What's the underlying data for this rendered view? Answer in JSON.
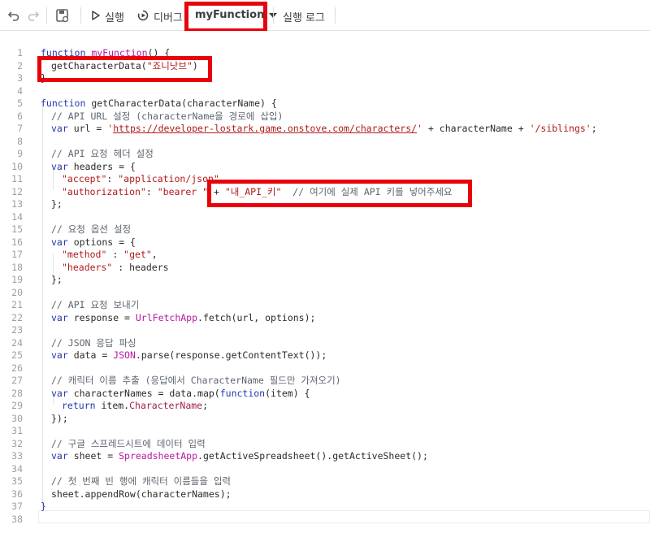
{
  "toolbar": {
    "run_label": "실행",
    "debug_label": "디버그",
    "function_name": "myFunction",
    "log_label": "실행 로그"
  },
  "code_lines": [
    {
      "n": "1",
      "indent": 0,
      "tokens": [
        [
          "kw",
          "function "
        ],
        [
          "fn",
          "myFunction"
        ],
        [
          "pl",
          "() {"
        ]
      ]
    },
    {
      "n": "2",
      "indent": 1,
      "tokens": [
        [
          "pl",
          "getCharacterData("
        ],
        [
          "str",
          "\"죠니낫브\""
        ],
        [
          "pl",
          ")"
        ]
      ]
    },
    {
      "n": "3",
      "indent": 0,
      "tokens": [
        [
          "pl",
          "}"
        ]
      ]
    },
    {
      "n": "4",
      "indent": 0,
      "tokens": []
    },
    {
      "n": "5",
      "indent": 0,
      "tokens": [
        [
          "kw",
          "function "
        ],
        [
          "pl",
          "getCharacterData(characterName) {"
        ]
      ]
    },
    {
      "n": "6",
      "indent": 1,
      "tokens": [
        [
          "cm",
          "// API URL 설정 (characterName을 경로에 삽입)"
        ]
      ]
    },
    {
      "n": "7",
      "indent": 1,
      "tokens": [
        [
          "kw",
          "var "
        ],
        [
          "pl",
          "url = "
        ],
        [
          "str",
          "'"
        ],
        [
          "url",
          "https://developer-lostark.game.onstove.com/characters/"
        ],
        [
          "str",
          "'"
        ],
        [
          "pl",
          " + characterName + "
        ],
        [
          "str",
          "'/siblings'"
        ],
        [
          "pl",
          ";"
        ]
      ]
    },
    {
      "n": "8",
      "indent": 0,
      "tokens": []
    },
    {
      "n": "9",
      "indent": 1,
      "tokens": [
        [
          "cm",
          "// API 요청 헤더 설정"
        ]
      ]
    },
    {
      "n": "10",
      "indent": 1,
      "tokens": [
        [
          "kw",
          "var "
        ],
        [
          "pl",
          "headers = {"
        ]
      ]
    },
    {
      "n": "11",
      "indent": 2,
      "tokens": [
        [
          "str",
          "\"accept\""
        ],
        [
          "pl",
          ": "
        ],
        [
          "str",
          "\"application/json\""
        ],
        [
          "pl",
          ","
        ]
      ]
    },
    {
      "n": "12",
      "indent": 2,
      "tokens": [
        [
          "str",
          "\"authorization\""
        ],
        [
          "pl",
          ": "
        ],
        [
          "str",
          "\"bearer \""
        ],
        [
          "pl",
          " + "
        ],
        [
          "str",
          "\"내_API_키\""
        ],
        [
          "pl",
          "  "
        ],
        [
          "cm",
          "// 여기에 실제 API 키를 넣어주세요"
        ]
      ]
    },
    {
      "n": "13",
      "indent": 1,
      "tokens": [
        [
          "pl",
          "};"
        ]
      ]
    },
    {
      "n": "14",
      "indent": 0,
      "tokens": []
    },
    {
      "n": "15",
      "indent": 1,
      "tokens": [
        [
          "cm",
          "// 요청 옵션 설정"
        ]
      ]
    },
    {
      "n": "16",
      "indent": 1,
      "tokens": [
        [
          "kw",
          "var "
        ],
        [
          "pl",
          "options = {"
        ]
      ]
    },
    {
      "n": "17",
      "indent": 2,
      "tokens": [
        [
          "str",
          "\"method\""
        ],
        [
          "pl",
          " : "
        ],
        [
          "str",
          "\"get\""
        ],
        [
          "pl",
          ","
        ]
      ]
    },
    {
      "n": "18",
      "indent": 2,
      "tokens": [
        [
          "str",
          "\"headers\""
        ],
        [
          "pl",
          " : headers"
        ]
      ]
    },
    {
      "n": "19",
      "indent": 1,
      "tokens": [
        [
          "pl",
          "};"
        ]
      ]
    },
    {
      "n": "20",
      "indent": 0,
      "tokens": []
    },
    {
      "n": "21",
      "indent": 1,
      "tokens": [
        [
          "cm",
          "// API 요청 보내기"
        ]
      ]
    },
    {
      "n": "22",
      "indent": 1,
      "tokens": [
        [
          "kw",
          "var "
        ],
        [
          "pl",
          "response = "
        ],
        [
          "fn",
          "UrlFetchApp"
        ],
        [
          "pl",
          ".fetch(url, options);"
        ]
      ]
    },
    {
      "n": "23",
      "indent": 0,
      "tokens": []
    },
    {
      "n": "24",
      "indent": 1,
      "tokens": [
        [
          "cm",
          "// JSON 응답 파싱"
        ]
      ]
    },
    {
      "n": "25",
      "indent": 1,
      "tokens": [
        [
          "kw",
          "var "
        ],
        [
          "pl",
          "data = "
        ],
        [
          "fn",
          "JSON"
        ],
        [
          "pl",
          ".parse(response.getContentText());"
        ]
      ]
    },
    {
      "n": "26",
      "indent": 0,
      "tokens": []
    },
    {
      "n": "27",
      "indent": 1,
      "tokens": [
        [
          "cm",
          "// 캐릭터 이름 추출 (응답에서 CharacterName 필드만 가져오기)"
        ]
      ]
    },
    {
      "n": "28",
      "indent": 1,
      "tokens": [
        [
          "kw",
          "var "
        ],
        [
          "pl",
          "characterNames = data.map("
        ],
        [
          "kw",
          "function"
        ],
        [
          "pl",
          "(item) {"
        ]
      ]
    },
    {
      "n": "29",
      "indent": 2,
      "tokens": [
        [
          "kw",
          "return "
        ],
        [
          "pl",
          "item."
        ],
        [
          "prop",
          "CharacterName"
        ],
        [
          "pl",
          ";"
        ]
      ]
    },
    {
      "n": "30",
      "indent": 1,
      "tokens": [
        [
          "pl",
          "});"
        ]
      ]
    },
    {
      "n": "31",
      "indent": 0,
      "tokens": []
    },
    {
      "n": "32",
      "indent": 1,
      "tokens": [
        [
          "cm",
          "// 구글 스프레드시트에 데이터 입력"
        ]
      ]
    },
    {
      "n": "33",
      "indent": 1,
      "tokens": [
        [
          "kw",
          "var "
        ],
        [
          "pl",
          "sheet = "
        ],
        [
          "fn",
          "SpreadsheetApp"
        ],
        [
          "pl",
          ".getActiveSpreadsheet().getActiveSheet();"
        ]
      ]
    },
    {
      "n": "34",
      "indent": 0,
      "tokens": []
    },
    {
      "n": "35",
      "indent": 1,
      "tokens": [
        [
          "cm",
          "// 첫 번째 빈 행에 캐릭터 이름들을 입력"
        ]
      ]
    },
    {
      "n": "36",
      "indent": 1,
      "tokens": [
        [
          "pl",
          "sheet.appendRow(characterNames);"
        ]
      ]
    },
    {
      "n": "37",
      "indent": 0,
      "tokens": [
        [
          "kw",
          "}"
        ]
      ]
    },
    {
      "n": "38",
      "indent": 0,
      "tokens": []
    }
  ],
  "colors": {
    "keyword": "#2437ad",
    "string": "#b01a1a",
    "comment": "#5e6570",
    "function": "#b5179e",
    "highlight_box": "#e8000b"
  },
  "icons": [
    "undo-icon",
    "redo-icon",
    "save-icon",
    "play-icon",
    "debug-icon",
    "dropdown-caret-icon"
  ]
}
